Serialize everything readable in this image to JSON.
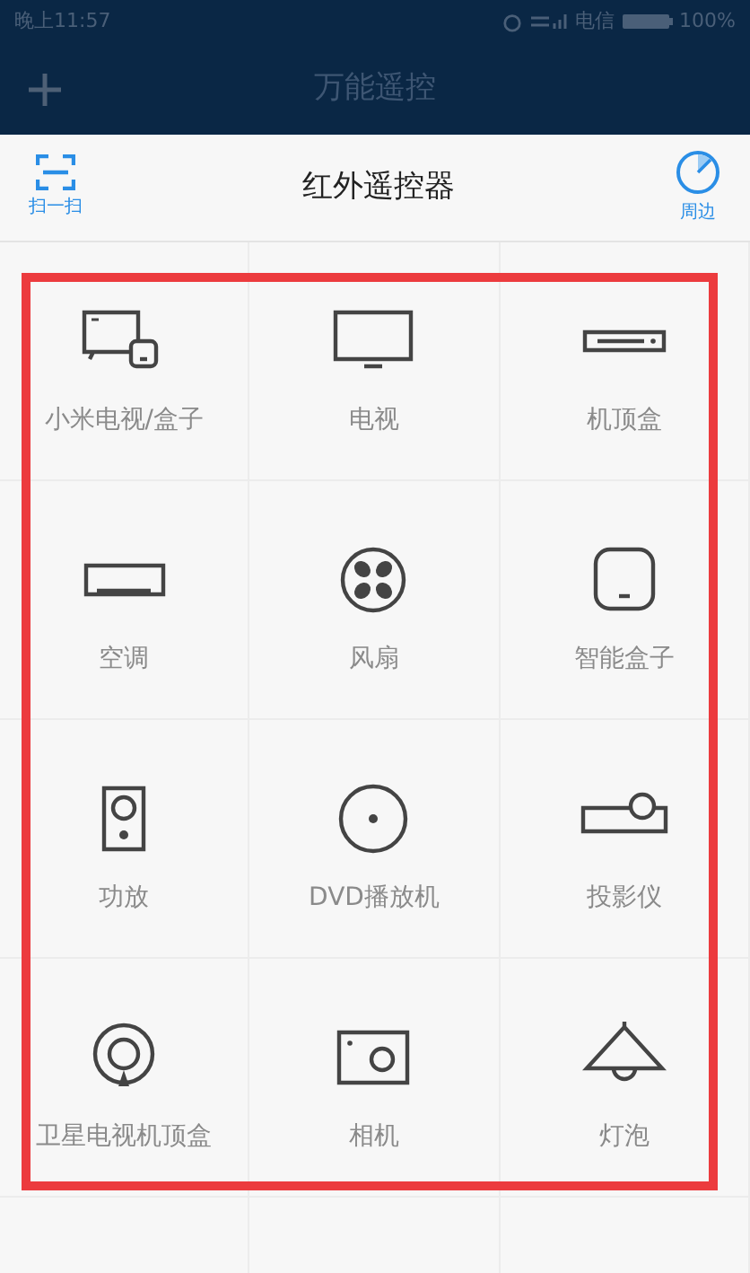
{
  "status_bar": {
    "time": "晚上11:57",
    "carrier": "电信",
    "battery": "100%"
  },
  "app_bar": {
    "title": "万能遥控"
  },
  "header": {
    "scan_label": "扫一扫",
    "title": "红外遥控器",
    "nearby_label": "周边"
  },
  "devices": [
    {
      "kind": "mitv",
      "label": "小米电视/盒子"
    },
    {
      "kind": "tv",
      "label": "电视"
    },
    {
      "kind": "stb",
      "label": "机顶盒"
    },
    {
      "kind": "ac",
      "label": "空调"
    },
    {
      "kind": "fan",
      "label": "风扇"
    },
    {
      "kind": "box",
      "label": "智能盒子"
    },
    {
      "kind": "speaker",
      "label": "功放"
    },
    {
      "kind": "disc",
      "label": "DVD播放机"
    },
    {
      "kind": "projector",
      "label": "投影仪"
    },
    {
      "kind": "satellite",
      "label": "卫星电视机顶盒"
    },
    {
      "kind": "camera",
      "label": "相机"
    },
    {
      "kind": "lamp",
      "label": "灯泡"
    }
  ]
}
